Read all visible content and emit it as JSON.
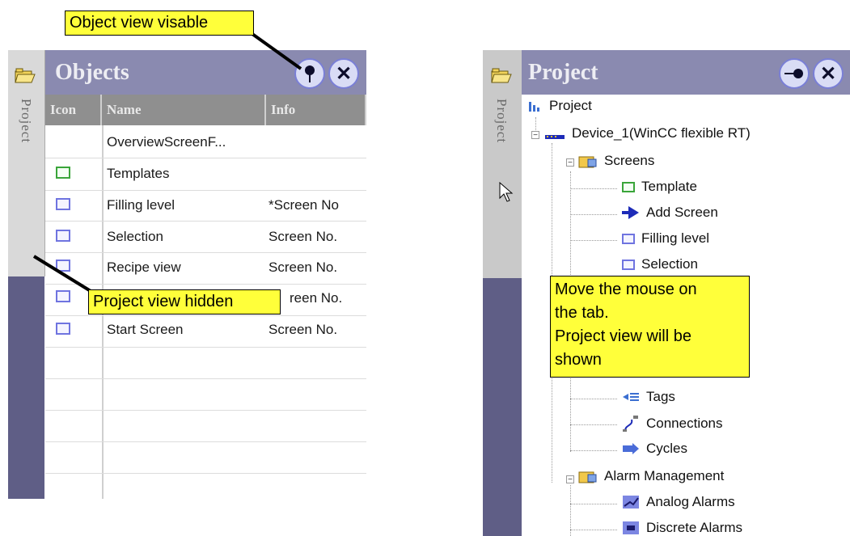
{
  "left_panel": {
    "header_title": "Objects",
    "side_tab_label": "Project",
    "columns": [
      "Icon",
      "Name",
      "Info"
    ],
    "rows": [
      {
        "icon": "",
        "name": "OverviewScreenF...",
        "info": ""
      },
      {
        "icon": "template-screen-icon",
        "name": "Templates",
        "info": ""
      },
      {
        "icon": "screen-icon",
        "name": "Filling level",
        "info": "*Screen No"
      },
      {
        "icon": "screen-icon",
        "name": "Selection",
        "info": "Screen No."
      },
      {
        "icon": "screen-icon",
        "name": "Recipe view",
        "info": "Screen No."
      },
      {
        "icon": "screen-icon",
        "name": "",
        "info": "reen No."
      },
      {
        "icon": "screen-icon",
        "name": "Start Screen",
        "info": "Screen No."
      }
    ],
    "callout_top": "Object view visable",
    "callout_bottom": "Project view hidden"
  },
  "right_panel": {
    "header_title": "Project",
    "side_tab_label": "Project",
    "tree": {
      "root": "Project",
      "device": "Device_1(WinCC flexible RT)",
      "screens": "Screens",
      "template": "Template",
      "add_screen": "Add Screen",
      "filling_level": "Filling level",
      "selection": "Selection",
      "tags": "Tags",
      "connections": "Connections",
      "cycles": "Cycles",
      "alarm_management": "Alarm Management",
      "analog_alarms": "Analog Alarms",
      "discrete_alarms": "Discrete Alarms"
    },
    "callout": {
      "line1": "Move the mouse on",
      "line2": "the tab.",
      "line3": "Project view will be",
      "line4": "shown"
    }
  },
  "colors": {
    "header": "#8a8ab0",
    "side_strip": "#5f5e86",
    "callout": "#ffff3a",
    "screen_icon": "#6f74e0",
    "template_icon": "#3aa53a"
  }
}
